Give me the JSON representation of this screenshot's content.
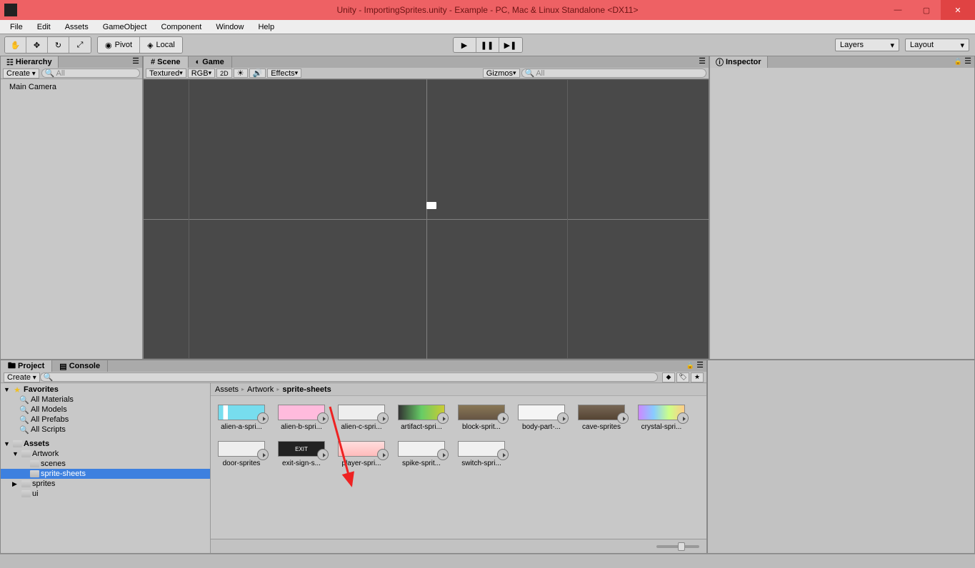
{
  "window": {
    "title": "Unity - ImportingSprites.unity - Example - PC, Mac & Linux Standalone <DX11>",
    "minimize": "—",
    "maximize": "▢",
    "close": "✕"
  },
  "menu": [
    "File",
    "Edit",
    "Assets",
    "GameObject",
    "Component",
    "Window",
    "Help"
  ],
  "toolbar": {
    "pivot": "Pivot",
    "local": "Local",
    "layers": "Layers",
    "layout": "Layout"
  },
  "hierarchy": {
    "tab": "Hierarchy",
    "create": "Create",
    "search_placeholder": "All",
    "items": [
      "Main Camera"
    ]
  },
  "scene": {
    "tabs": [
      "Scene",
      "Game"
    ],
    "shading": "Textured",
    "render": "RGB",
    "mode2d": "2D",
    "effects": "Effects",
    "gizmos": "Gizmos",
    "search_placeholder": "All"
  },
  "inspector": {
    "tab": "Inspector"
  },
  "project": {
    "tabs": [
      "Project",
      "Console"
    ],
    "create": "Create",
    "favorites_header": "Favorites",
    "favorites": [
      "All Materials",
      "All Models",
      "All Prefabs",
      "All Scripts"
    ],
    "assets_header": "Assets",
    "tree": [
      {
        "label": "Artwork",
        "depth": 1,
        "expandable": true,
        "expanded": true
      },
      {
        "label": "scenes",
        "depth": 2,
        "expandable": false
      },
      {
        "label": "sprite-sheets",
        "depth": 2,
        "expandable": false,
        "selected": true
      },
      {
        "label": "sprites",
        "depth": 1,
        "expandable": true,
        "expanded": false
      },
      {
        "label": "ui",
        "depth": 1,
        "expandable": false
      }
    ],
    "breadcrumb": [
      "Assets",
      "Artwork",
      "sprite-sheets"
    ],
    "assets": [
      "alien-a-spri...",
      "alien-b-spri...",
      "alien-c-spri...",
      "artifact-spri...",
      "block-sprit...",
      "body-part-...",
      "cave-sprites",
      "crystal-spri...",
      "door-sprites",
      "exit-sign-s...",
      "player-spri...",
      "spike-sprit...",
      "switch-spri..."
    ]
  }
}
